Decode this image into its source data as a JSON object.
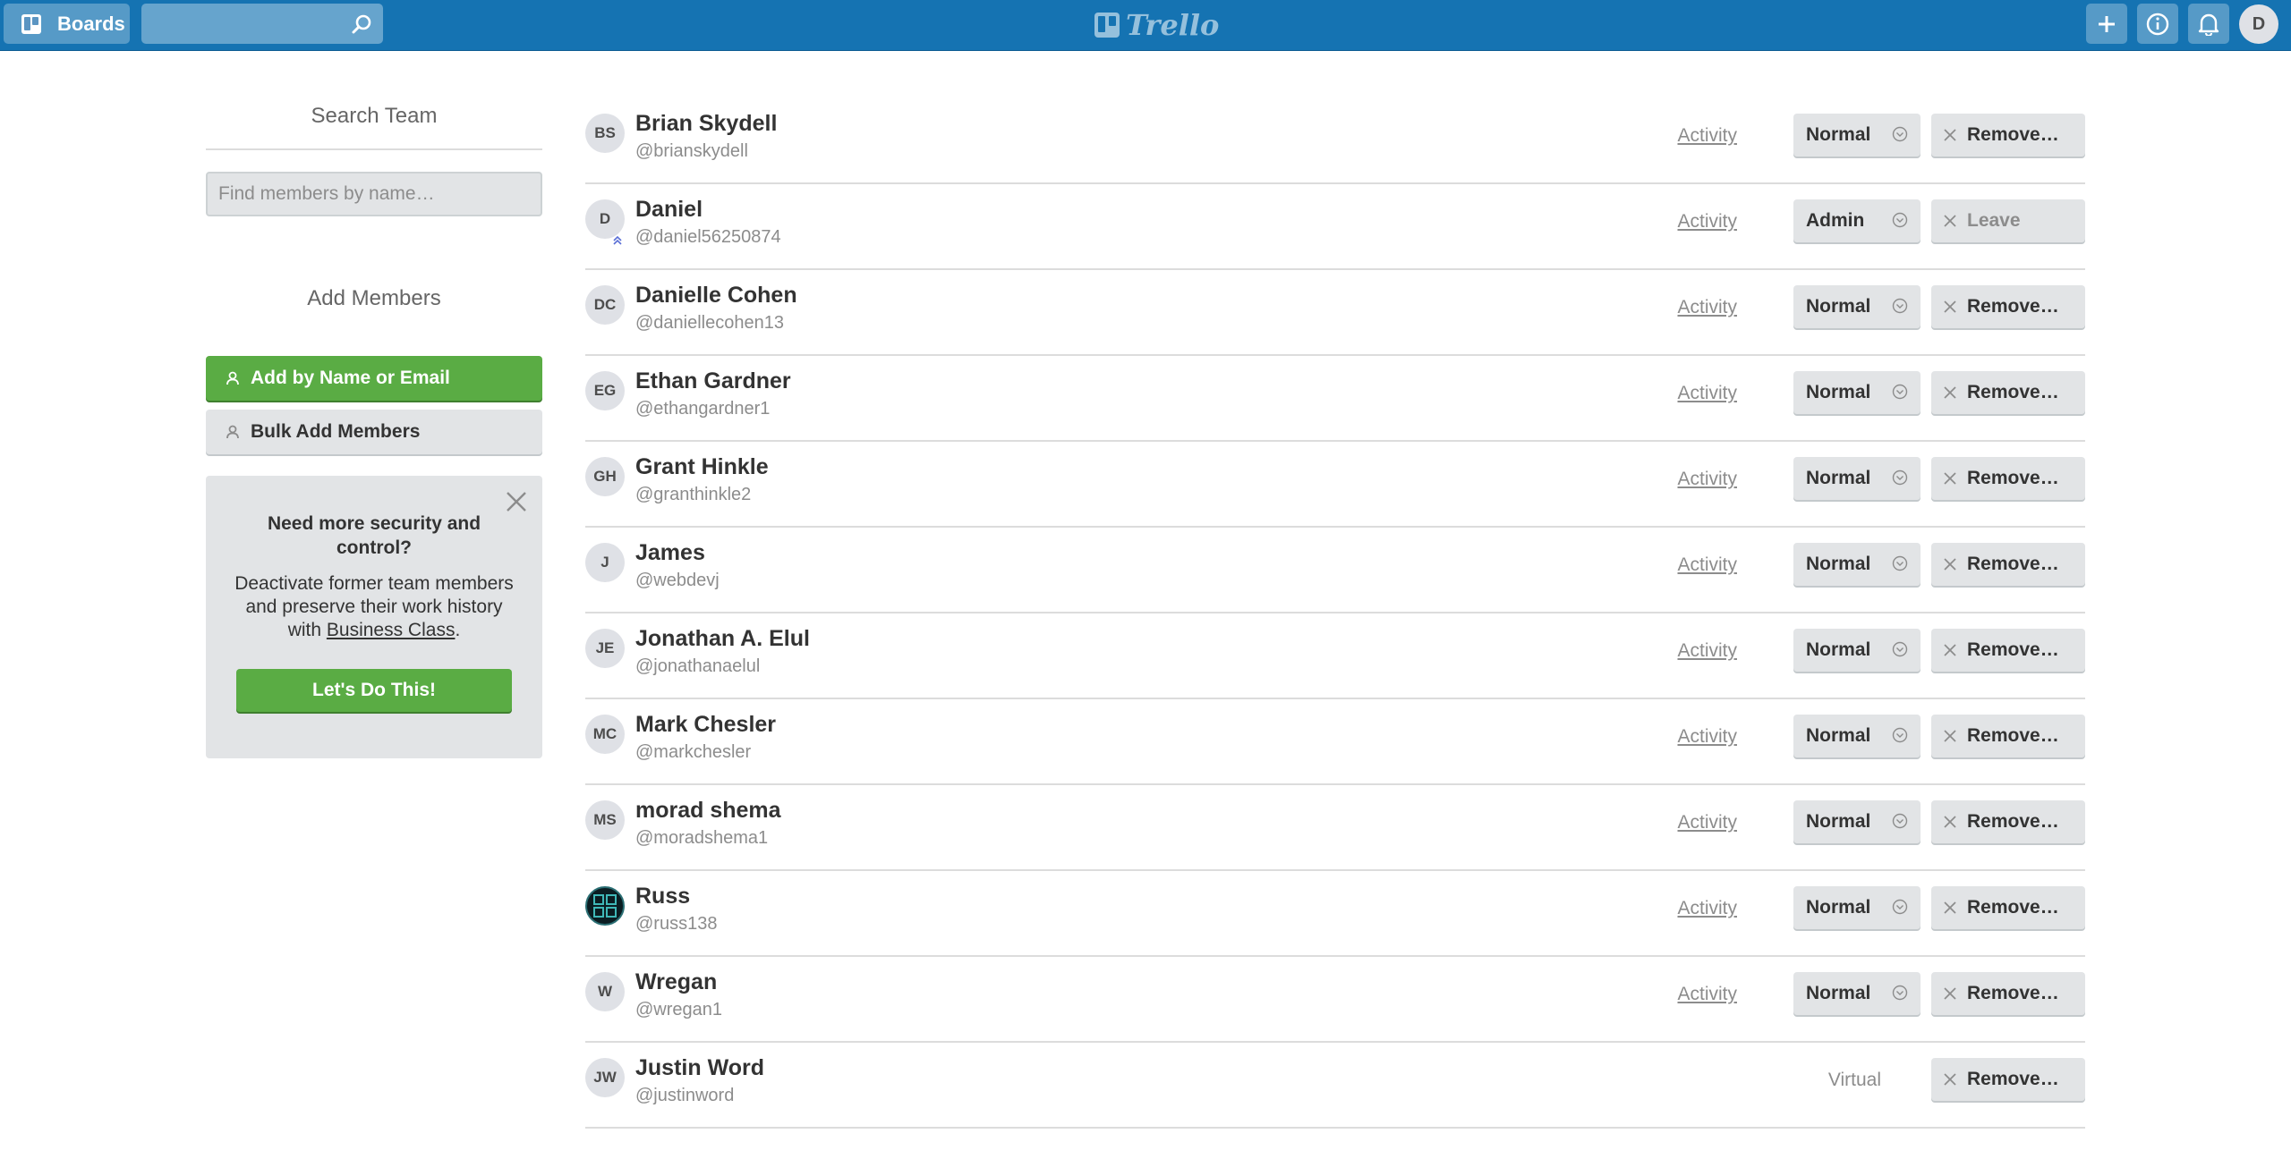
{
  "header": {
    "boards_label": "Boards",
    "search_value": "",
    "logo_text": "Trello",
    "avatar_initial": "D"
  },
  "sidebar": {
    "search_title": "Search Team",
    "find_placeholder": "Find members by name…",
    "add_title": "Add Members",
    "add_by_name_label": "Add by Name or Email",
    "bulk_add_label": "Bulk Add Members",
    "promo": {
      "title": "Need more security and control?",
      "text_before": "Deactivate former team members and preserve their work history with",
      "link_text": "Business Class",
      "text_after": ".",
      "button_label": "Let's Do This!"
    }
  },
  "members": [
    {
      "initials": "BS",
      "name": "Brian Skydell",
      "username": "@brianskydell",
      "activity": "Activity",
      "role": "Normal",
      "action": "Remove…"
    },
    {
      "initials": "D",
      "name": "Daniel",
      "username": "@daniel56250874",
      "activity": "Activity",
      "role": "Admin",
      "action": "Leave",
      "is_admin": true
    },
    {
      "initials": "DC",
      "name": "Danielle Cohen",
      "username": "@daniellecohen13",
      "activity": "Activity",
      "role": "Normal",
      "action": "Remove…"
    },
    {
      "initials": "EG",
      "name": "Ethan Gardner",
      "username": "@ethangardner1",
      "activity": "Activity",
      "role": "Normal",
      "action": "Remove…"
    },
    {
      "initials": "GH",
      "name": "Grant Hinkle",
      "username": "@granthinkle2",
      "activity": "Activity",
      "role": "Normal",
      "action": "Remove…"
    },
    {
      "initials": "J",
      "name": "James",
      "username": "@webdevj",
      "activity": "Activity",
      "role": "Normal",
      "action": "Remove…"
    },
    {
      "initials": "JE",
      "name": "Jonathan A. Elul",
      "username": "@jonathanaelul",
      "activity": "Activity",
      "role": "Normal",
      "action": "Remove…"
    },
    {
      "initials": "MC",
      "name": "Mark Chesler",
      "username": "@markchesler",
      "activity": "Activity",
      "role": "Normal",
      "action": "Remove…"
    },
    {
      "initials": "MS",
      "name": "morad shema",
      "username": "@moradshema1",
      "activity": "Activity",
      "role": "Normal",
      "action": "Remove…"
    },
    {
      "initials": "",
      "name": "Russ",
      "username": "@russ138",
      "activity": "Activity",
      "role": "Normal",
      "action": "Remove…",
      "avatar_image": true
    },
    {
      "initials": "W",
      "name": "Wregan",
      "username": "@wregan1",
      "activity": "Activity",
      "role": "Normal",
      "action": "Remove…"
    },
    {
      "initials": "JW",
      "name": "Justin Word",
      "username": "@justinword",
      "status": "Virtual",
      "action": "Remove…"
    }
  ]
}
